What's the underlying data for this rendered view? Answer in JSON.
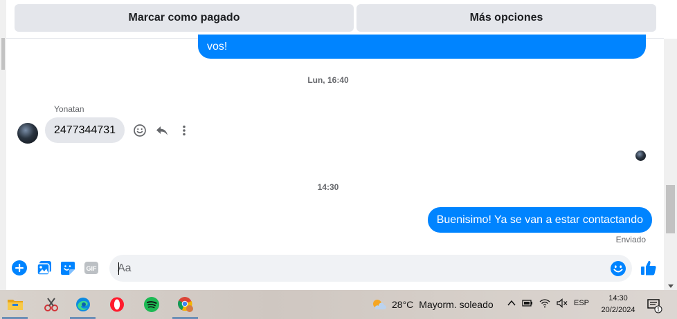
{
  "actions": {
    "mark_paid": "Marcar como pagado",
    "more_options": "Más opciones"
  },
  "chat": {
    "top_message_tail": "vos!",
    "timestamp_1": "Lun, 16:40",
    "incoming": {
      "sender": "Yonatan",
      "text": "2477344731"
    },
    "timestamp_2": "14:30",
    "outgoing_last": "Buenisimo! Ya se van a estar contactando",
    "status": "Enviado"
  },
  "composer": {
    "placeholder": "Aa",
    "icons": [
      "plus-icon",
      "image-icon",
      "sticker-icon",
      "gif-icon",
      "emoji-icon",
      "like-icon"
    ],
    "gif_label": "GIF"
  },
  "taskbar": {
    "apps": [
      "file-explorer-icon",
      "snipping-tool-icon",
      "edge-icon",
      "opera-icon",
      "spotify-icon",
      "chrome-icon"
    ],
    "weather_temp": "28°C",
    "weather_desc": "Mayorm. soleado",
    "language": "ESP",
    "time": "14:30",
    "date": "20/2/2024",
    "notification_count": "1"
  },
  "colors": {
    "accent": "#0084ff",
    "bubble_in": "#e4e6eb",
    "button_bg": "#e4e6eb"
  }
}
